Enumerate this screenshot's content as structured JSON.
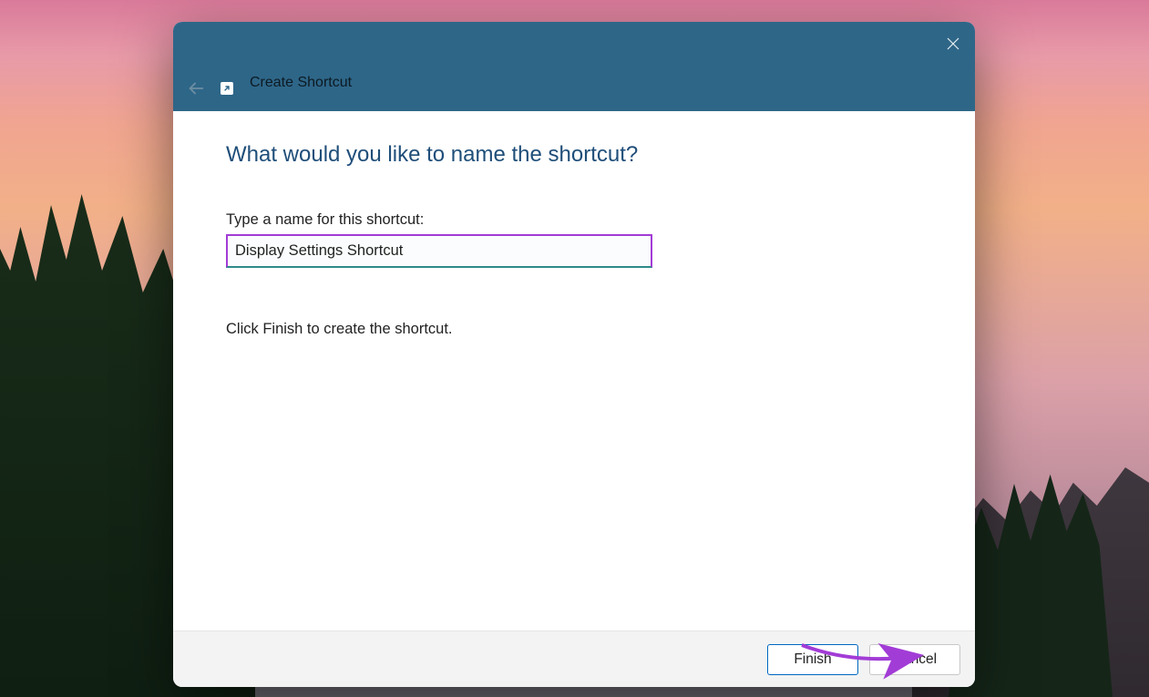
{
  "dialog": {
    "window_title": "Create Shortcut",
    "heading": "What would you like to name the shortcut?",
    "input_label": "Type a name for this shortcut:",
    "input_value": "Display Settings Shortcut",
    "instruction": "Click Finish to create the shortcut.",
    "buttons": {
      "finish": "Finish",
      "cancel": "Cancel"
    }
  },
  "colors": {
    "titlebar_bg": "#2e6688",
    "heading_color": "#1f4e79",
    "highlight_border": "#a23cd6",
    "input_underline": "#2e8a8a",
    "primary_button_border": "#0067c0"
  }
}
